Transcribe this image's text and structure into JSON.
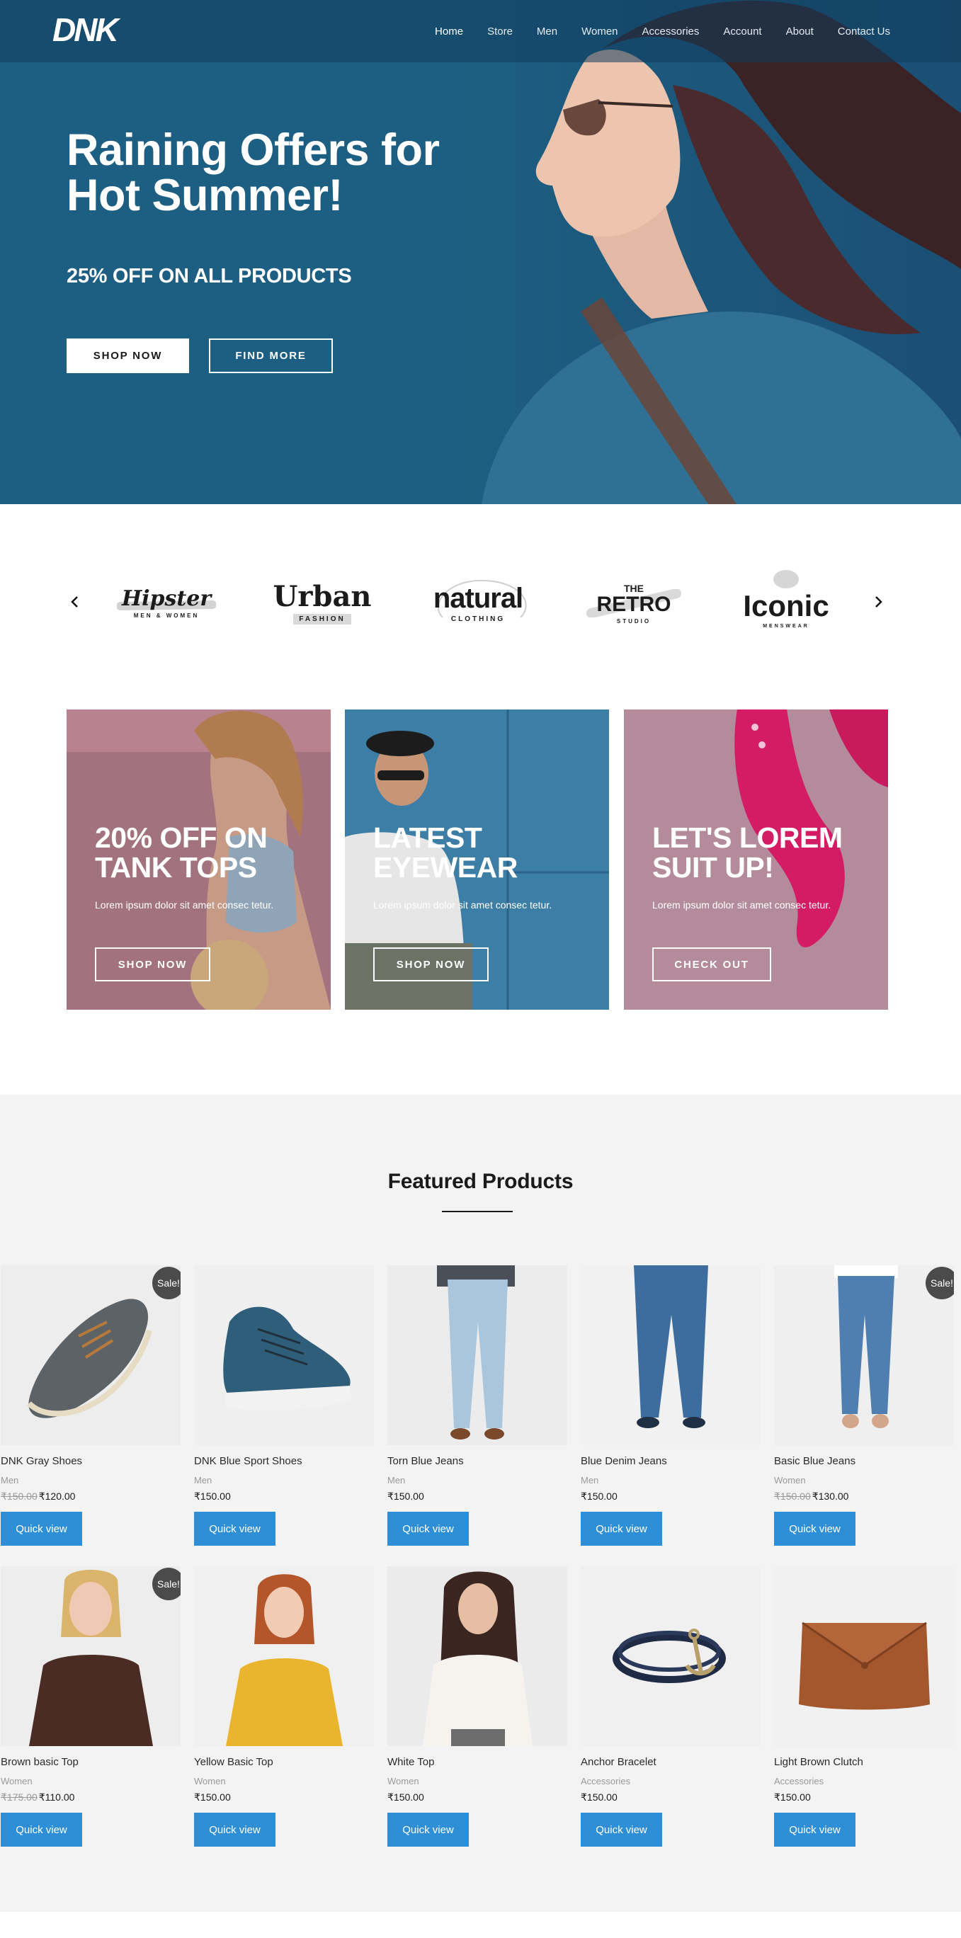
{
  "header": {
    "logo_text": "DNK",
    "nav": [
      {
        "label": "Home",
        "active": true
      },
      {
        "label": "Store"
      },
      {
        "label": "Men"
      },
      {
        "label": "Women"
      },
      {
        "label": "Accessories"
      },
      {
        "label": "Account"
      },
      {
        "label": "About"
      },
      {
        "label": "Contact Us"
      }
    ]
  },
  "hero": {
    "title": "Raining Offers for Hot Summer!",
    "subtitle": "25% OFF ON ALL PRODUCTS",
    "primary_button": "SHOP NOW",
    "secondary_button": "FIND MORE"
  },
  "brands": {
    "prev_icon": "chevron-left-icon",
    "next_icon": "chevron-right-icon",
    "items": [
      {
        "name": "Hipster",
        "tagline": "MEN & WOMEN"
      },
      {
        "name": "Urban",
        "tagline": "FASHION"
      },
      {
        "name": "natural",
        "tagline": "CLOTHING"
      },
      {
        "name": "RETRO",
        "prefix": "THE",
        "tagline": "STUDIO"
      },
      {
        "name": "Iconic",
        "tagline": "MENSWEAR"
      }
    ]
  },
  "promos": [
    {
      "title": "20% OFF ON TANK TOPS",
      "text": "Lorem ipsum dolor sit amet consec tetur.",
      "button": "SHOP NOW",
      "color": "#a3727f"
    },
    {
      "title": "LATEST EYEWEAR",
      "text": "Lorem ipsum dolor sit amet consec tetur.",
      "button": "SHOP NOW",
      "color": "#3c7ea6"
    },
    {
      "title": "LET'S LOREM SUIT UP!",
      "text": "Lorem ipsum dolor sit amet consec tetur.",
      "button": "CHECK OUT",
      "color": "#b48b9b"
    }
  ],
  "featured": {
    "title": "Featured Products",
    "sale_label": "Sale!",
    "quick_view": "Quick view",
    "products": [
      {
        "name": "DNK Gray Shoes",
        "category": "Men",
        "old_price": "₹150.00",
        "price": "₹120.00",
        "sale": true
      },
      {
        "name": "DNK Blue Sport Shoes",
        "category": "Men",
        "price": "₹150.00",
        "sale": false
      },
      {
        "name": "Torn Blue Jeans",
        "category": "Men",
        "price": "₹150.00",
        "sale": false
      },
      {
        "name": "Blue Denim Jeans",
        "category": "Men",
        "price": "₹150.00",
        "sale": false
      },
      {
        "name": "Basic Blue Jeans",
        "category": "Women",
        "old_price": "₹150.00",
        "price": "₹130.00",
        "sale": true
      },
      {
        "name": "Brown basic Top",
        "category": "Women",
        "old_price": "₹175.00",
        "price": "₹110.00",
        "sale": true
      },
      {
        "name": "Yellow Basic Top",
        "category": "Women",
        "price": "₹150.00",
        "sale": false
      },
      {
        "name": "White Top",
        "category": "Women",
        "price": "₹150.00",
        "sale": false
      },
      {
        "name": "Anchor Bracelet",
        "category": "Accessories",
        "price": "₹150.00",
        "sale": false
      },
      {
        "name": "Light Brown Clutch",
        "category": "Accessories",
        "price": "₹150.00",
        "sale": false
      }
    ]
  },
  "colors": {
    "hero_bg": "#1d5f82",
    "accent_button": "#2f8fd6",
    "sale_badge": "#4b4b4b",
    "featured_bg": "#f3f3f3"
  }
}
